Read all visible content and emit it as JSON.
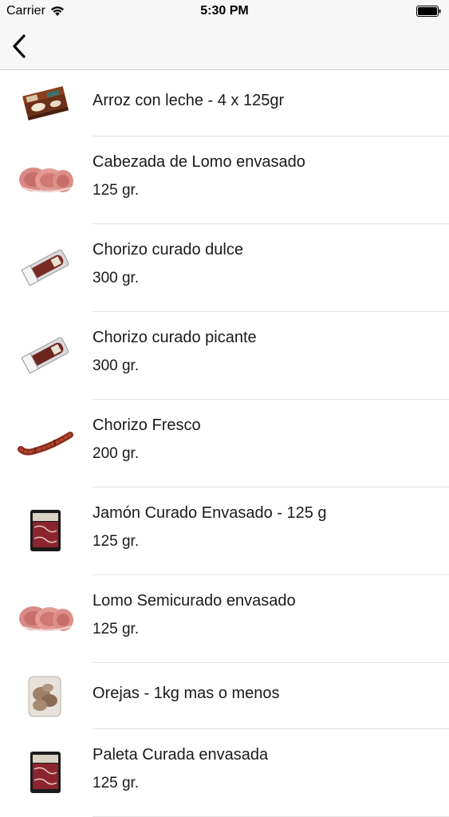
{
  "status_bar": {
    "carrier": "Carrier",
    "time": "5:30 PM"
  },
  "nav": {
    "back_icon": "chevron-left-icon"
  },
  "products": [
    {
      "title": "Arroz con leche - 4 x 125gr",
      "subtitle": "",
      "image": "rice-pudding-pack"
    },
    {
      "title": "Cabezada de Lomo envasado",
      "subtitle": "125 gr.",
      "image": "sliced-loin"
    },
    {
      "title": "Chorizo curado dulce",
      "subtitle": "300 gr.",
      "image": "packaged-chorizo"
    },
    {
      "title": "Chorizo curado picante",
      "subtitle": "300 gr.",
      "image": "packaged-chorizo"
    },
    {
      "title": "Chorizo Fresco",
      "subtitle": "200 gr.",
      "image": "fresh-chorizo-link"
    },
    {
      "title": "Jamón Curado Envasado - 125 g",
      "subtitle": "125 gr.",
      "image": "ham-tray"
    },
    {
      "title": "Lomo Semicurado envasado",
      "subtitle": "125 gr.",
      "image": "sliced-loin"
    },
    {
      "title": "Orejas - 1kg mas o menos",
      "subtitle": "",
      "image": "ears-bag"
    },
    {
      "title": "Paleta Curada envasada",
      "subtitle": "125 gr.",
      "image": "ham-tray"
    }
  ]
}
